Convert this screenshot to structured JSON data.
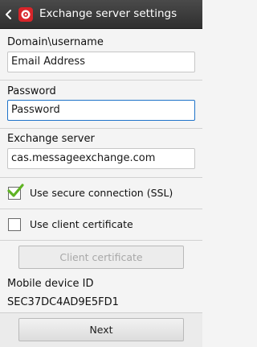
{
  "header": {
    "title": "Exchange server settings",
    "back_icon": "back-chevron-icon",
    "app_icon": "email-app-icon"
  },
  "fields": {
    "domain_username": {
      "label": "Domain\\username",
      "value": "Email Address"
    },
    "password": {
      "label": "Password",
      "value": "Password"
    },
    "exchange_server": {
      "label": "Exchange server",
      "value": "cas.messageexchange.com"
    }
  },
  "options": {
    "secure_connection": {
      "label": "Use secure connection (SSL)",
      "checked": true
    },
    "client_certificate": {
      "label": "Use client certificate",
      "checked": false
    }
  },
  "buttons": {
    "client_certificate": "Client certificate",
    "next": "Next"
  },
  "device": {
    "label": "Mobile device ID",
    "value": "SEC37DC4AD9E5FD1"
  },
  "colors": {
    "focus": "#1f73c9",
    "check": "#5fb323",
    "header": "#3a3a3a",
    "app_icon": "#d8252a"
  }
}
